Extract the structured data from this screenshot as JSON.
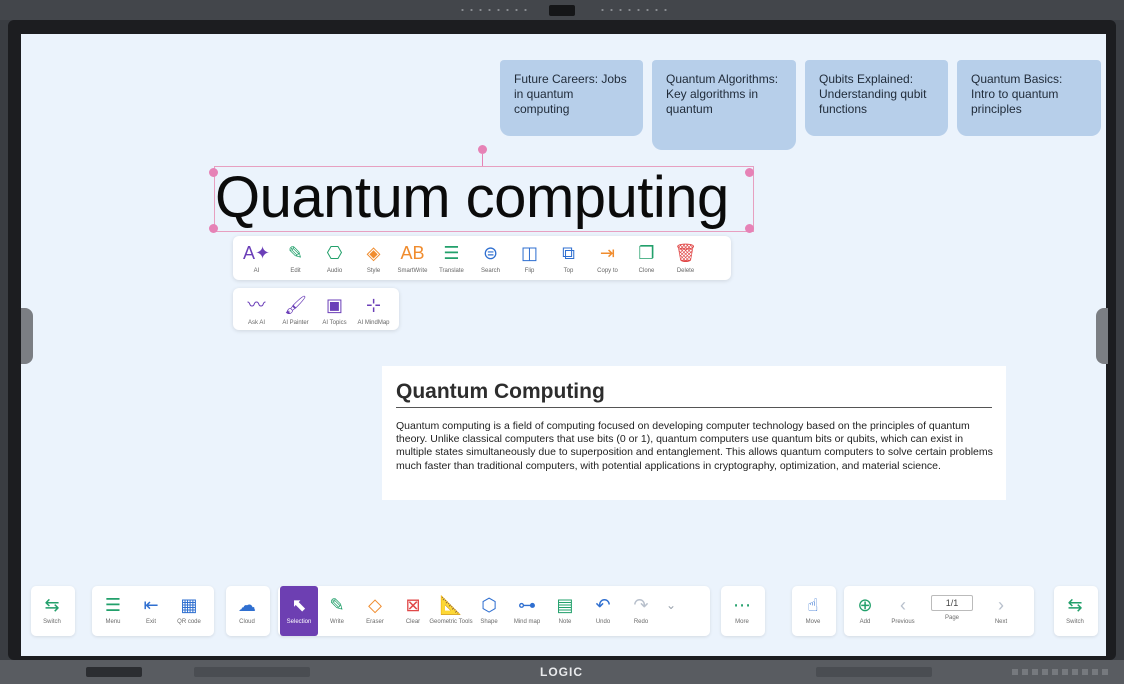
{
  "brand": "LOGIC",
  "notes": [
    {
      "text": "Future Careers: Jobs in quantum computing"
    },
    {
      "text": "Quantum Algorithms: Key algorithms in quantum"
    },
    {
      "text": "Qubits Explained: Understanding qubit functions"
    },
    {
      "text": "Quantum Basics: Intro to quantum principles"
    }
  ],
  "selected_text": "Quantum computing",
  "context_toolbar": [
    {
      "label": "AI",
      "icon": "ai-text-icon",
      "glyph": "A✦",
      "color": "#6b3fb8"
    },
    {
      "label": "Edit",
      "icon": "edit-icon",
      "glyph": "✎",
      "color": "#22a06b"
    },
    {
      "label": "Audio",
      "icon": "audio-icon",
      "glyph": "⎔",
      "color": "#22a06b"
    },
    {
      "label": "Style",
      "icon": "style-icon",
      "glyph": "◈",
      "color": "#f08c2e"
    },
    {
      "label": "SmartWrite",
      "icon": "smartwrite-icon",
      "glyph": "AB",
      "color": "#f08c2e"
    },
    {
      "label": "Translate",
      "icon": "translate-icon",
      "glyph": "☰",
      "color": "#22a06b"
    },
    {
      "label": "Search",
      "icon": "search-icon",
      "glyph": "⊜",
      "color": "#2f6fd0"
    },
    {
      "label": "Flip",
      "icon": "flip-icon",
      "glyph": "◫",
      "color": "#2f6fd0"
    },
    {
      "label": "Top",
      "icon": "top-icon",
      "glyph": "⧉",
      "color": "#2f6fd0"
    },
    {
      "label": "Copy to",
      "icon": "copy-to-icon",
      "glyph": "⇥",
      "color": "#f08c2e"
    },
    {
      "label": "Clone",
      "icon": "clone-icon",
      "glyph": "❐",
      "color": "#22a06b"
    },
    {
      "label": "Delete",
      "icon": "delete-icon",
      "glyph": "🗑",
      "color": "#e04848"
    }
  ],
  "ai_toolbar": [
    {
      "label": "Ask AI",
      "icon": "ask-ai-icon",
      "glyph": "〰",
      "color": "#6b3fb8"
    },
    {
      "label": "AI Painter",
      "icon": "ai-painter-icon",
      "glyph": "🖌",
      "color": "#6b3fb8"
    },
    {
      "label": "AI Topics",
      "icon": "ai-topics-icon",
      "glyph": "▣",
      "color": "#6b3fb8"
    },
    {
      "label": "AI MindMap",
      "icon": "ai-mindmap-icon",
      "glyph": "⊹",
      "color": "#6b3fb8"
    }
  ],
  "card": {
    "title": "Quantum Computing",
    "body": "Quantum computing is a field of computing focused on developing computer technology based on the principles of quantum theory. Unlike classical computers that use bits (0 or 1), quantum computers use quantum bits or qubits, which can exist in multiple states simultaneously due to superposition and entanglement. This allows quantum computers to solve certain problems much faster than traditional computers, with potential applications in cryptography, optimization, and material science."
  },
  "dock": {
    "switch_left": {
      "label": "Switch",
      "icon": "switch-icon",
      "glyph": "⇆"
    },
    "menu_group": [
      {
        "label": "Menu",
        "icon": "menu-icon",
        "glyph": "☰"
      },
      {
        "label": "Exit",
        "icon": "exit-icon",
        "glyph": "⇤"
      },
      {
        "label": "QR code",
        "icon": "qr-code-icon",
        "glyph": "▦"
      }
    ],
    "cloud": {
      "label": "Cloud",
      "icon": "cloud-icon",
      "glyph": "☁"
    },
    "tools": [
      {
        "label": "Selection",
        "icon": "selection-icon",
        "glyph": "⬉",
        "active": true,
        "color": "#ffffff"
      },
      {
        "label": "Write",
        "icon": "write-icon",
        "glyph": "✎",
        "color": "#22a06b"
      },
      {
        "label": "Eraser",
        "icon": "eraser-icon",
        "glyph": "◇",
        "color": "#f08c2e"
      },
      {
        "label": "Clear",
        "icon": "clear-icon",
        "glyph": "⊠",
        "color": "#e04848"
      },
      {
        "label": "Geometric Tools",
        "icon": "geometric-tools-icon",
        "glyph": "📐",
        "color": "#2f6fd0"
      },
      {
        "label": "Shape",
        "icon": "shape-icon",
        "glyph": "⬡",
        "color": "#2f6fd0"
      },
      {
        "label": "Mind map",
        "icon": "mind-map-icon",
        "glyph": "⊶",
        "color": "#2f6fd0"
      },
      {
        "label": "Note",
        "icon": "note-icon",
        "glyph": "▤",
        "color": "#22a06b"
      },
      {
        "label": "Undo",
        "icon": "undo-icon",
        "glyph": "↶",
        "color": "#2f6fd0"
      },
      {
        "label": "Redo",
        "icon": "redo-icon",
        "glyph": "↷",
        "color": "#b8c0cc"
      }
    ],
    "more": {
      "label": "More",
      "icon": "more-icon",
      "glyph": "⋯"
    },
    "move": {
      "label": "Move",
      "icon": "move-hand-icon",
      "glyph": "☝"
    },
    "pages": {
      "add": {
        "label": "Add",
        "icon": "add-page-icon",
        "glyph": "⊕"
      },
      "previous": {
        "label": "Previous",
        "icon": "previous-icon",
        "glyph": "‹"
      },
      "page": {
        "label": "Page",
        "value": "1/1"
      },
      "next": {
        "label": "Next",
        "icon": "next-icon",
        "glyph": "›"
      }
    },
    "switch_right": {
      "label": "Switch",
      "icon": "switch-icon",
      "glyph": "⇆"
    }
  }
}
